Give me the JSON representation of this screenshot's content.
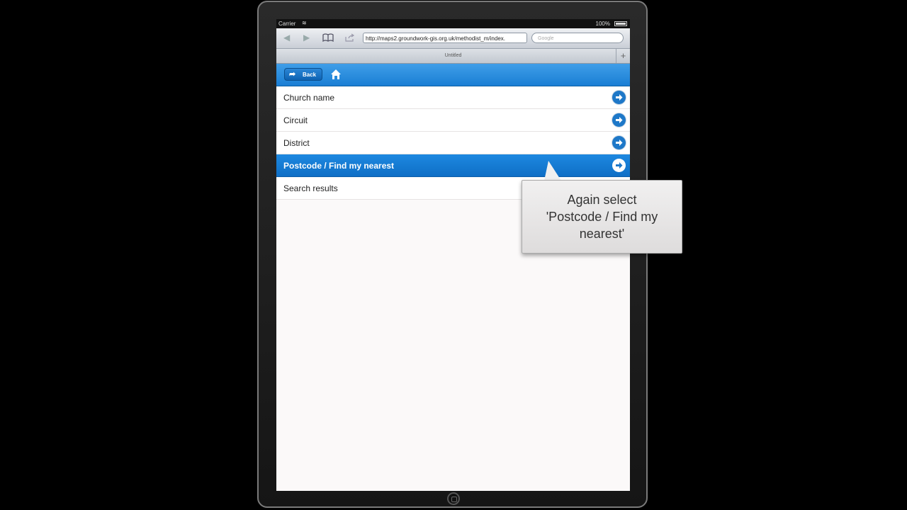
{
  "status_bar": {
    "carrier": "Carrier",
    "battery": "100%"
  },
  "browser": {
    "url": "http://maps2.groundwork-gis.org.uk/methodist_m/index.",
    "search_placeholder": "Google",
    "tab_title": "Untitled",
    "new_tab_label": "+"
  },
  "header": {
    "back_label": "Back"
  },
  "list": {
    "items": [
      {
        "label": "Church name"
      },
      {
        "label": "Circuit"
      },
      {
        "label": "District"
      },
      {
        "label": "Postcode / Find my nearest"
      },
      {
        "label": "Search results"
      }
    ]
  },
  "callout": {
    "line1": "Again select",
    "line2": "'Postcode / Find my",
    "line3": "nearest'"
  },
  "colors": {
    "header_blue": "#1a7ed4",
    "selected_blue": "#0f6fc6",
    "arrow_blue": "#1e78c8"
  }
}
